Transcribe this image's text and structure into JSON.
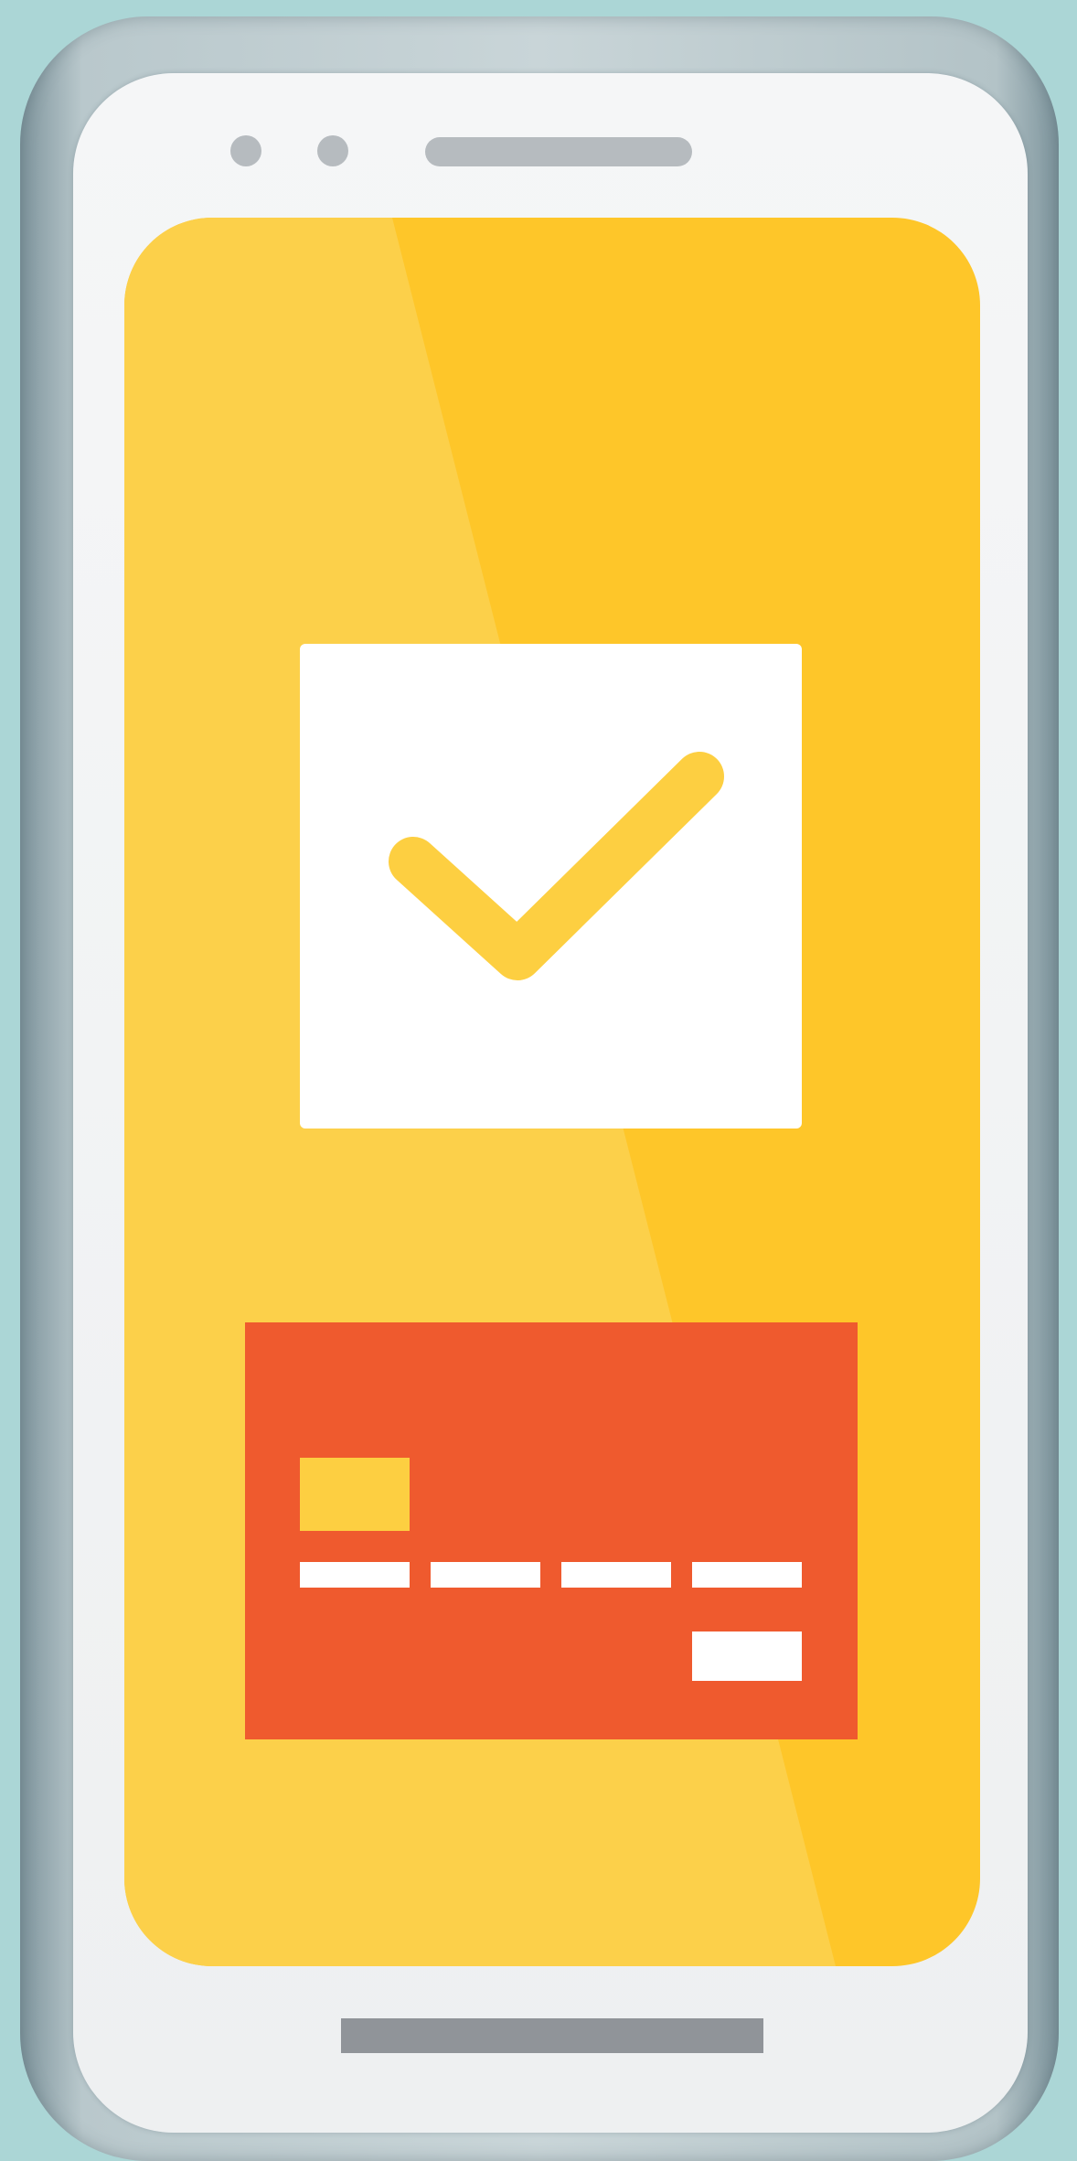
{
  "illustration": {
    "subject": "smartphone-payment-confirmation",
    "icons": {
      "confirm": "checkmark-icon",
      "card": "credit-card-icon"
    },
    "colors": {
      "background": "#abd6d6",
      "phone_body": "#c9d5d8",
      "phone_face": "#f2f3f4",
      "screen": "#fec629",
      "screen_highlight": "#fcd04a",
      "check_tile": "#ffffff",
      "check_mark": "#fdcf41",
      "card": "#ef5a2e",
      "card_chip": "#fdcf41",
      "card_lines": "#ffffff",
      "hardware_gray": "#b6bbbf",
      "home_bar": "#909499"
    }
  }
}
